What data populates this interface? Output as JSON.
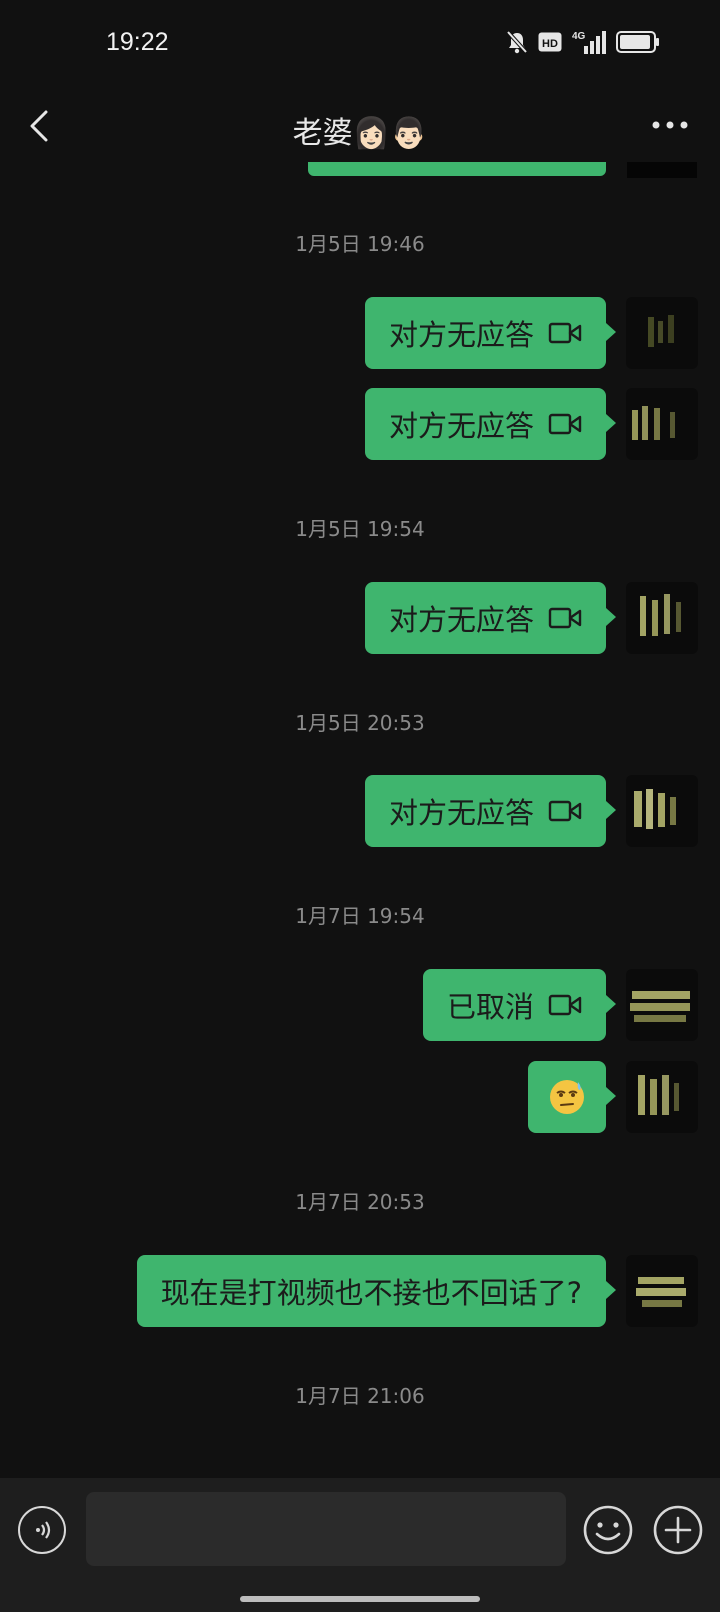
{
  "status_bar": {
    "time": "19:22",
    "icons": [
      "bell-muted-icon",
      "hd-icon",
      "4g-signal-icon",
      "battery-icon"
    ],
    "hd_label": "HD",
    "network_label": "4G"
  },
  "nav": {
    "back_icon": "chevron-left-icon",
    "title": "老婆👩🏻👨🏻",
    "more_icon": "more-dots-icon"
  },
  "colors": {
    "background": "#111111",
    "bubble": "#3fb56e",
    "timestamp": "#8a8a8a",
    "input_bar": "#1e1e1e"
  },
  "messages": [
    {
      "timestamp": "1月5日 19:46"
    },
    {
      "text": "对方无应答",
      "icon": "video-call-icon"
    },
    {
      "text": "对方无应答",
      "icon": "video-call-icon"
    },
    {
      "timestamp": "1月5日 19:54"
    },
    {
      "text": "对方无应答",
      "icon": "video-call-icon"
    },
    {
      "timestamp": "1月5日 20:53"
    },
    {
      "text": "对方无应答",
      "icon": "video-call-icon"
    },
    {
      "timestamp": "1月7日 19:54"
    },
    {
      "text": "已取消",
      "icon": "video-call-icon"
    },
    {
      "emoji": "sweat-emoji-icon"
    },
    {
      "timestamp": "1月7日 20:53"
    },
    {
      "text": "现在是打视频也不接也不回话了?"
    },
    {
      "timestamp": "1月7日 21:06"
    }
  ],
  "input_bar": {
    "voice_icon": "voice-icon",
    "emoji_icon": "emoji-icon",
    "plus_icon": "plus-icon"
  }
}
